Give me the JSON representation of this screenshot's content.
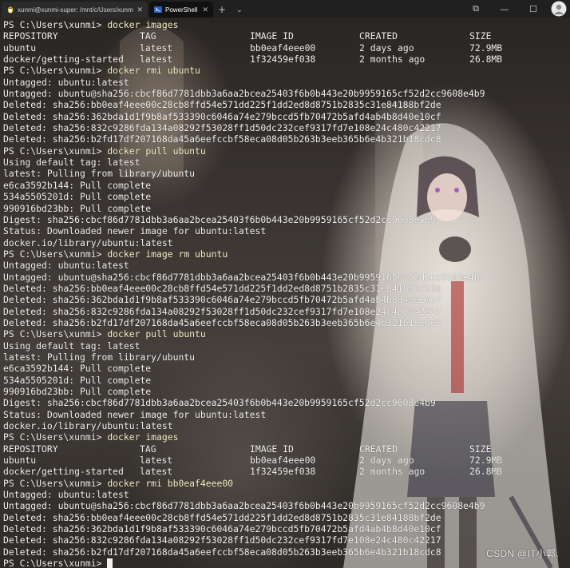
{
  "tabs": [
    {
      "label": "xunmi@xunmi-super: /mnt/c/Users/xunmi",
      "icon": "linux-penguin-icon",
      "active": false
    },
    {
      "label": "PowerShell",
      "icon": "powershell-icon",
      "active": true
    }
  ],
  "titlebar": {
    "new_tab": "+",
    "dropdown": "⌄"
  },
  "window": {
    "minimize": "—",
    "maximize": "☐",
    "restore": "⧉"
  },
  "prompt": "PS C:\\Users\\xunmi> ",
  "blocks": [
    {
      "type": "prompt",
      "cmd": "docker images"
    },
    {
      "type": "table",
      "cols": [
        "REPOSITORY",
        "TAG",
        "IMAGE ID",
        "CREATED",
        "SIZE"
      ]
    },
    {
      "type": "table",
      "cols": [
        "ubuntu",
        "latest",
        "bb0eaf4eee00",
        "2 days ago",
        "72.9MB"
      ]
    },
    {
      "type": "table",
      "cols": [
        "docker/getting-started",
        "latest",
        "1f32459ef038",
        "2 months ago",
        "26.8MB"
      ]
    },
    {
      "type": "prompt",
      "cmd": "docker rmi ubuntu"
    },
    {
      "type": "text",
      "text": "Untagged: ubuntu:latest"
    },
    {
      "type": "text",
      "text": "Untagged: ubuntu@sha256:cbcf86d7781dbb3a6aa2bcea25403f6b0b443e20b9959165cf52d2cc9608e4b9"
    },
    {
      "type": "text",
      "text": "Deleted: sha256:bb0eaf4eee00c28cb8ffd54e571dd225f1dd2ed8d8751b2835c31e84188bf2de"
    },
    {
      "type": "text",
      "text": "Deleted: sha256:362bda1d1f9b8af533390c6046a74e279bccd5fb70472b5afd4ab4b8d40e10cf"
    },
    {
      "type": "text",
      "text": "Deleted: sha256:832c9286fda134a08292f53028ff1d50dc232cef9317fd7e108e24c480c42217"
    },
    {
      "type": "text",
      "text": "Deleted: sha256:b2fd17df207168da45a6eefccbf58eca08d05b263b3eeb365b6e4b321b18cdc8"
    },
    {
      "type": "prompt",
      "cmd": "docker pull ubuntu"
    },
    {
      "type": "text",
      "text": "Using default tag: latest"
    },
    {
      "type": "text",
      "text": "latest: Pulling from library/ubuntu"
    },
    {
      "type": "text",
      "text": "e6ca3592b144: Pull complete"
    },
    {
      "type": "text",
      "text": "534a5505201d: Pull complete"
    },
    {
      "type": "text",
      "text": "990916bd23bb: Pull complete"
    },
    {
      "type": "text",
      "text": "Digest: sha256:cbcf86d7781dbb3a6aa2bcea25403f6b0b443e20b9959165cf52d2cc9608e4b9"
    },
    {
      "type": "text",
      "text": "Status: Downloaded newer image for ubuntu:latest"
    },
    {
      "type": "text",
      "text": "docker.io/library/ubuntu:latest"
    },
    {
      "type": "prompt",
      "cmd": "docker image rm ubuntu"
    },
    {
      "type": "text",
      "text": "Untagged: ubuntu:latest"
    },
    {
      "type": "text",
      "text": "Untagged: ubuntu@sha256:cbcf86d7781dbb3a6aa2bcea25403f6b0b443e20b9959165cf52d2cc9608e4b9"
    },
    {
      "type": "text",
      "text": "Deleted: sha256:bb0eaf4eee00c28cb8ffd54e571dd225f1dd2ed8d8751b2835c31e84188bf2de"
    },
    {
      "type": "text",
      "text": "Deleted: sha256:362bda1d1f9b8af533390c6046a74e279bccd5fb70472b5afd4ab4b8d40e10cf"
    },
    {
      "type": "text",
      "text": "Deleted: sha256:832c9286fda134a08292f53028ff1d50dc232cef9317fd7e108e24c480c42217"
    },
    {
      "type": "text",
      "text": "Deleted: sha256:b2fd17df207168da45a6eefccbf58eca08d05b263b3eeb365b6e4b321b18cdc8"
    },
    {
      "type": "prompt",
      "cmd": "docker pull ubuntu"
    },
    {
      "type": "text",
      "text": "Using default tag: latest"
    },
    {
      "type": "text",
      "text": "latest: Pulling from library/ubuntu"
    },
    {
      "type": "text",
      "text": "e6ca3592b144: Pull complete"
    },
    {
      "type": "text",
      "text": "534a5505201d: Pull complete"
    },
    {
      "type": "text",
      "text": "990916bd23bb: Pull complete"
    },
    {
      "type": "text",
      "text": "Digest: sha256:cbcf86d7781dbb3a6aa2bcea25403f6b0b443e20b9959165cf52d2cc9608e4b9"
    },
    {
      "type": "text",
      "text": "Status: Downloaded newer image for ubuntu:latest"
    },
    {
      "type": "text",
      "text": "docker.io/library/ubuntu:latest"
    },
    {
      "type": "prompt",
      "cmd": "docker images"
    },
    {
      "type": "table",
      "cols": [
        "REPOSITORY",
        "TAG",
        "IMAGE ID",
        "CREATED",
        "SIZE"
      ]
    },
    {
      "type": "table",
      "cols": [
        "ubuntu",
        "latest",
        "bb0eaf4eee00",
        "2 days ago",
        "72.9MB"
      ]
    },
    {
      "type": "table",
      "cols": [
        "docker/getting-started",
        "latest",
        "1f32459ef038",
        "2 months ago",
        "26.8MB"
      ]
    },
    {
      "type": "prompt",
      "cmd": "docker rmi bb0eaf4eee00"
    },
    {
      "type": "text",
      "text": "Untagged: ubuntu:latest"
    },
    {
      "type": "text",
      "text": "Untagged: ubuntu@sha256:cbcf86d7781dbb3a6aa2bcea25403f6b0b443e20b9959165cf52d2cc9608e4b9"
    },
    {
      "type": "text",
      "text": "Deleted: sha256:bb0eaf4eee00c28cb8ffd54e571dd225f1dd2ed8d8751b2835c31e84188bf2de"
    },
    {
      "type": "text",
      "text": "Deleted: sha256:362bda1d1f9b8af533390c6046a74e279bccd5fb70472b5afd4ab4b8d40e10cf"
    },
    {
      "type": "text",
      "text": "Deleted: sha256:832c9286fda134a08292f53028ff1d50dc232cef9317fd7e108e24c480c42217"
    },
    {
      "type": "text",
      "text": "Deleted: sha256:b2fd17df207168da45a6eefccbf58eca08d05b263b3eeb365b6e4b321b18cdc8"
    },
    {
      "type": "prompt",
      "cmd": "",
      "cursor": true
    }
  ],
  "watermark": "CSDN @IT小郭.",
  "colors": {
    "background": "#1b1a1c",
    "text": "#f2f2f2",
    "command": "#f5f2c8",
    "tabbar": "#202020"
  }
}
